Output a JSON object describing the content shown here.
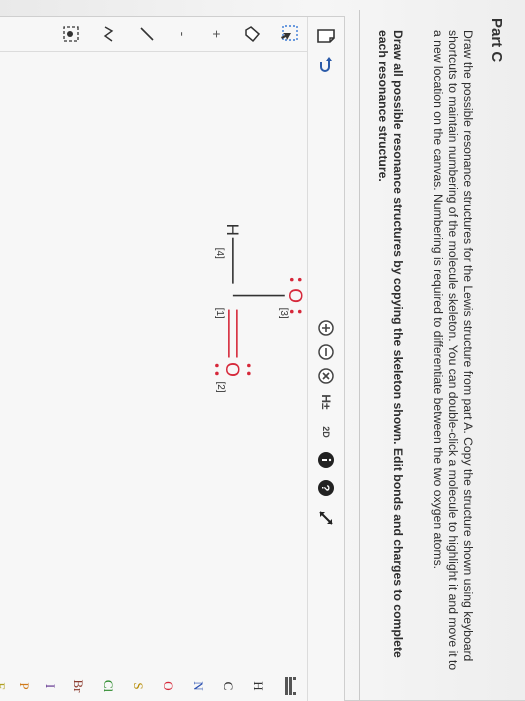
{
  "part": {
    "title": "Part C"
  },
  "instructions": {
    "paragraph1": "Draw the possible resonance structures for the Lewis structure from part A. Copy the structure shown using keyboard shortcuts to maintain numbering of the molecule skeleton. You can double-click a molecule to highlight it and move it to a new location on the canvas. Numbering is required to differentiate between the two oxygen atoms.",
    "paragraph2": "Draw all possible resonance structures by copying the skeleton shown. Edit bonds and charges to complete each resonance structure."
  },
  "toolbar": {
    "h_plus_label": "H±",
    "lone_pair_label": "2D",
    "icons": [
      "new-document-icon",
      "undo-icon",
      "positive-charge-icon",
      "negative-charge-icon",
      "remove-charge-icon",
      "explicit-hydrogen-icon",
      "lone-pair-icon",
      "info-icon",
      "help-icon",
      "fullscreen-icon"
    ]
  },
  "left_tools": [
    "select-icon",
    "eraser-icon",
    "plus-icon",
    "minus-icon",
    "single-bond-icon",
    "chain-icon",
    "template-icon"
  ],
  "atoms": [
    "H",
    "C",
    "N",
    "O",
    "S",
    "Cl",
    "Br",
    "I",
    "P",
    "F"
  ],
  "molecule": {
    "atoms": [
      {
        "label": "H",
        "number": "[4]"
      },
      {
        "label": "C",
        "number": "[1]"
      },
      {
        "label": "O",
        "number": "[3]"
      },
      {
        "label": "O",
        "number": "[2]"
      }
    ]
  },
  "colors": {
    "oxygen": "#d6283a",
    "text": "#333333",
    "toolbar_icon": "#444444"
  }
}
